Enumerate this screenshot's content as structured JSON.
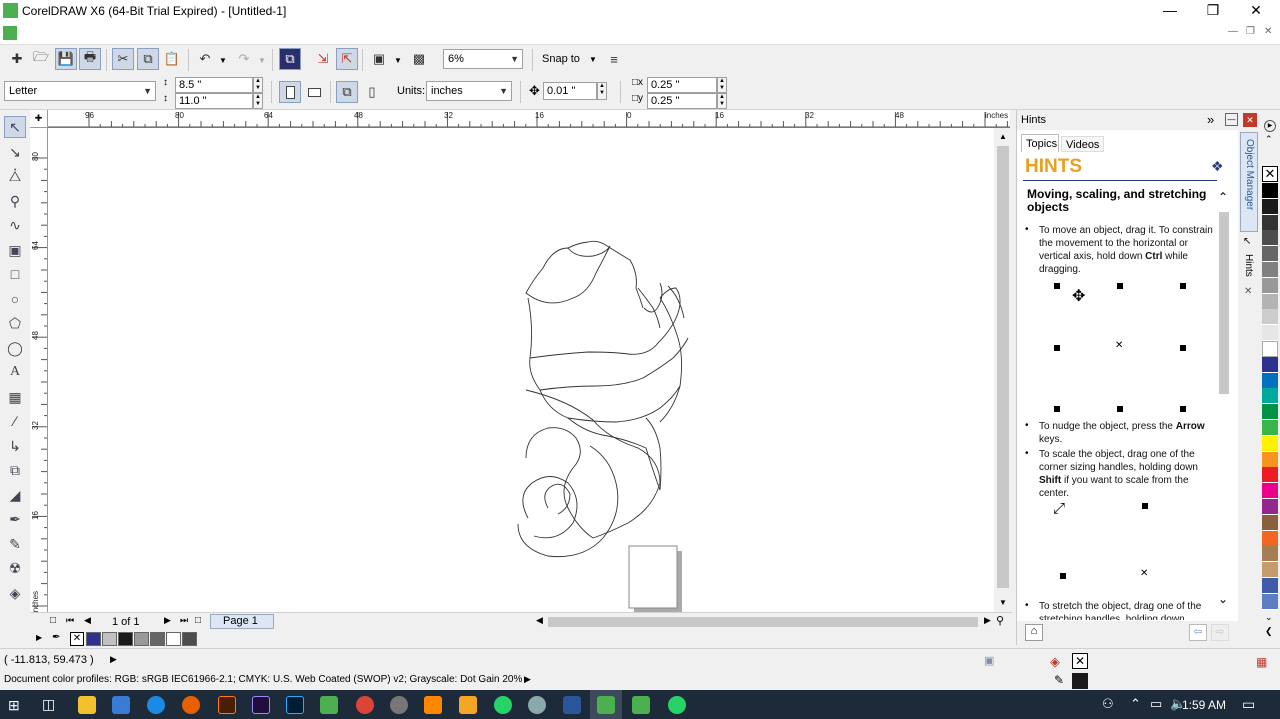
{
  "window": {
    "title": "CorelDRAW X6 (64-Bit Trial Expired) - [Untitled-1]"
  },
  "toolbar": {
    "zoom_value": "6%",
    "snap_label": "Snap to"
  },
  "propbar": {
    "page_size": "Letter",
    "width": "8.5 \"",
    "height": "11.0 \"",
    "units_label": "Units:",
    "units_value": "inches",
    "nudge": "0.01 \"",
    "dup_x": "0.25 \"",
    "dup_y": "0.25 \""
  },
  "rulers": {
    "h_labels": [
      "96",
      "80",
      "64",
      "48",
      "32",
      "16",
      "0",
      "16",
      "32",
      "48"
    ],
    "h_unit": "inches",
    "v_labels": [
      "80",
      "64",
      "48",
      "32",
      "16"
    ],
    "v_unit": "inches"
  },
  "pagebar": {
    "counter": "1 of 1",
    "tab": "Page 1"
  },
  "status": {
    "coords": "( -11.813, 59.473 )",
    "profiles": "Document color profiles: RGB: sRGB IEC61966-2.1; CMYK: U.S. Web Coated (SWOP) v2; Grayscale: Dot Gain 20%"
  },
  "hints": {
    "panel_title": "Hints",
    "tab_topics": "Topics",
    "tab_videos": "Videos",
    "heading": "HINTS",
    "topic_title": "Moving, scaling, and stretching objects",
    "b1_pre": "To move an object, drag it. To constrain the movement to the horizontal or vertical axis, hold down ",
    "b1_key": "Ctrl",
    "b1_post": " while dragging.",
    "b2_pre": "To nudge the object, press the ",
    "b2_key": "Arrow",
    "b2_post": " keys.",
    "b3_pre": "To scale the object, drag one of the corner sizing handles, holding down ",
    "b3_key": "Shift",
    "b3_post": " if you want to scale from the center.",
    "b4": "To stretch the object, drag one of the stretching handles, holding down"
  },
  "docker_tabs": {
    "object_manager": "Object Manager",
    "hints": "Hints"
  },
  "palette_colors": [
    "#000000",
    "#1a1a1a",
    "#333333",
    "#4d4d4d",
    "#666666",
    "#808080",
    "#999999",
    "#b3b3b3",
    "#cccccc",
    "#e6e6e6",
    "#ffffff",
    "#2e3192",
    "#0071bc",
    "#00a99d",
    "#009245",
    "#39b54a",
    "#fff200",
    "#f7941d",
    "#ed1c24",
    "#ec008c",
    "#92278f",
    "#8b5e3c",
    "#f26522",
    "#a67c52",
    "#c69c6d",
    "#3f5ba9",
    "#5a7fc1"
  ],
  "doc_palette": [
    "#2e3192",
    "#c0c0c0",
    "#1a1a1a",
    "#999999",
    "#666666",
    "#ffffff",
    "#4d4d4d"
  ],
  "taskbar": {
    "time": "1:59 AM"
  }
}
